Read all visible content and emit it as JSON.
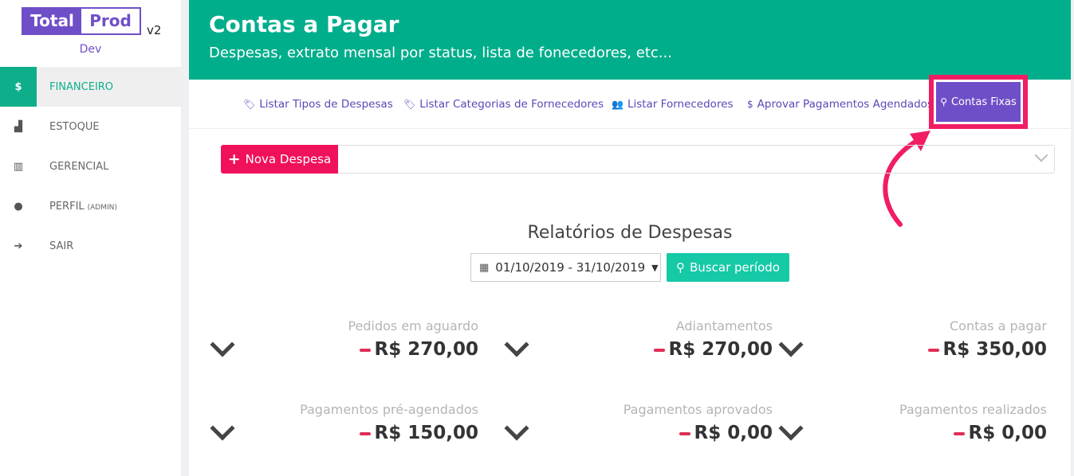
{
  "brand": {
    "part1": "Total",
    "part2": "Prod",
    "version": "v2",
    "env": "Dev"
  },
  "sidebar": {
    "items": [
      {
        "icon": "$",
        "label": "FINANCEIRO",
        "extra": ""
      },
      {
        "icon": "▟",
        "label": "ESTOQUE",
        "extra": ""
      },
      {
        "icon": "▥",
        "label": "GERENCIAL",
        "extra": ""
      },
      {
        "icon": "●",
        "label": "PERFIL",
        "extra": "(ADMIN)"
      },
      {
        "icon": "➔",
        "label": "SAIR",
        "extra": ""
      }
    ]
  },
  "header": {
    "title": "Contas a Pagar",
    "subtitle": "Despesas, extrato mensal por status, lista de fonecedores, etc..."
  },
  "tabs": [
    {
      "icon": "🏷",
      "label": "Listar Tipos de Despesas"
    },
    {
      "icon": "🏷",
      "label": "Listar Categorias de Fornecedores"
    },
    {
      "icon": "👥",
      "label": "Listar Fornecedores"
    },
    {
      "icon": "$",
      "label": "Aprovar Pagamentos Agendados"
    },
    {
      "icon": "⚲",
      "label": "Contas Fixas"
    }
  ],
  "toolbar": {
    "new_label": "Nova Despesa",
    "plus": "+"
  },
  "report": {
    "title": "Relatórios de Despesas",
    "period": "01/10/2019 - 31/10/2019",
    "search_label": "Buscar período"
  },
  "cards": [
    {
      "label": "Pedidos em aguardo",
      "value": "R$ 270,00"
    },
    {
      "label": "Adiantamentos",
      "value": "R$ 270,00"
    },
    {
      "label": "Contas a pagar",
      "value": "R$ 350,00"
    },
    {
      "label": "Pagamentos pré-agendados",
      "value": "R$ 150,00"
    },
    {
      "label": "Pagamentos aprovados",
      "value": "R$ 0,00"
    },
    {
      "label": "Pagamentos realizados",
      "value": "R$ 0,00"
    }
  ],
  "colors": {
    "primary": "#00ae8c",
    "accent": "#6f4fc8",
    "danger": "#f0115b",
    "highlight": "#f11d62"
  }
}
